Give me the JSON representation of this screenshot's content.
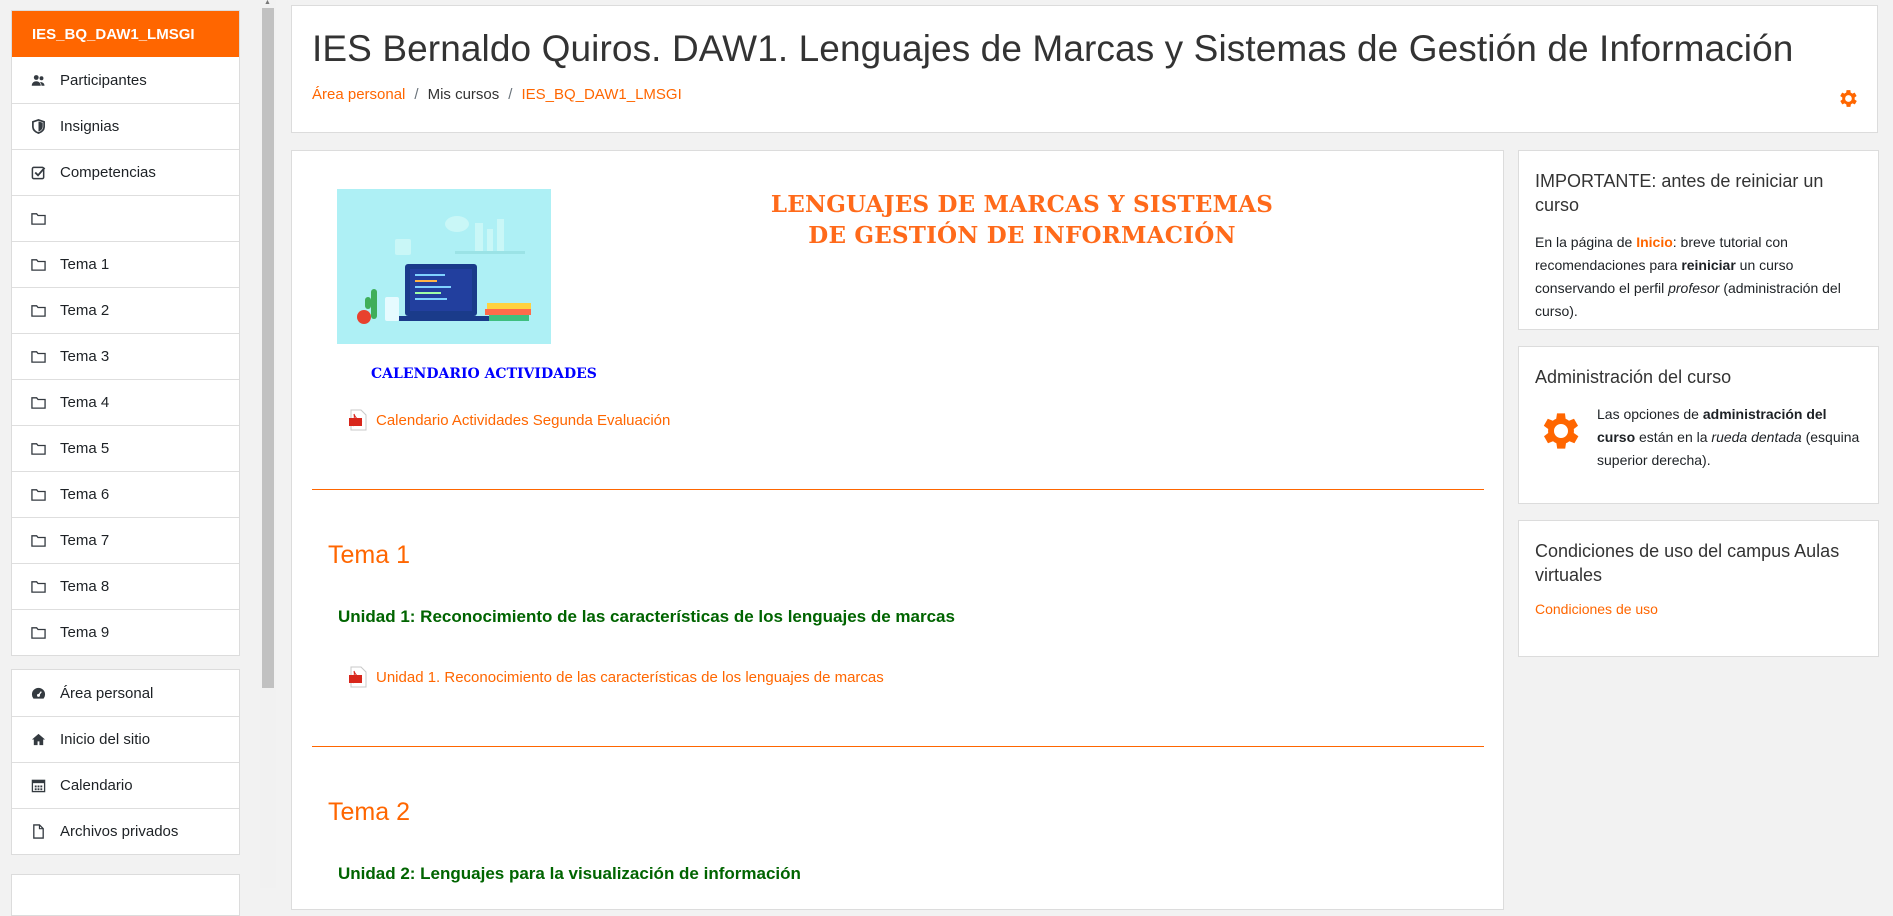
{
  "drawer": {
    "course_short_name": "IES_BQ_DAW1_LMSGI",
    "course_items": [
      {
        "label": "Participantes",
        "icon": "users-icon"
      },
      {
        "label": "Insignias",
        "icon": "shield-icon"
      },
      {
        "label": "Competencias",
        "icon": "checkbox-icon"
      },
      {
        "label": "",
        "icon": "folder-icon"
      },
      {
        "label": "Tema 1",
        "icon": "folder-icon"
      },
      {
        "label": "Tema 2",
        "icon": "folder-icon"
      },
      {
        "label": "Tema 3",
        "icon": "folder-icon"
      },
      {
        "label": "Tema 4",
        "icon": "folder-icon"
      },
      {
        "label": "Tema 5",
        "icon": "folder-icon"
      },
      {
        "label": "Tema 6",
        "icon": "folder-icon"
      },
      {
        "label": "Tema 7",
        "icon": "folder-icon"
      },
      {
        "label": "Tema 8",
        "icon": "folder-icon"
      },
      {
        "label": "Tema 9",
        "icon": "folder-icon"
      }
    ],
    "general_items": [
      {
        "label": "Área personal",
        "icon": "dashboard-icon"
      },
      {
        "label": "Inicio del sitio",
        "icon": "home-icon"
      },
      {
        "label": "Calendario",
        "icon": "calendar-icon"
      },
      {
        "label": "Archivos privados",
        "icon": "file-icon"
      }
    ]
  },
  "header": {
    "title": "IES Bernaldo Quiros. DAW1. Lenguajes de Marcas y Sistemas de Gestión de Información",
    "breadcrumb": [
      "Área personal",
      "Mis cursos",
      "IES_BQ_DAW1_LMSGI"
    ]
  },
  "course": {
    "heading_line1": "LENGUAJES DE MARCAS Y SISTEMAS",
    "heading_line2": "DE GESTIÓN DE INFORMACIÓN",
    "calendar_title": "CALENDARIO ACTIVIDADES",
    "calendar_resource": "Calendario Actividades Segunda Evaluación",
    "sections": [
      {
        "title": "Tema 1",
        "unit": "Unidad 1: Reconocimiento de las características de los lenguajes de marcas",
        "resource": "Unidad 1. Reconocimiento de las características de los lenguajes de marcas"
      },
      {
        "title": "Tema 2",
        "unit": "Unidad 2: Lenguajes para la visualización de información",
        "resource": ""
      }
    ]
  },
  "blocks": {
    "important": {
      "title": "IMPORTANTE: antes de reiniciar un curso",
      "text_1": "En la página de ",
      "inicio": "Inicio",
      "text_2": ": breve tutorial con recomendaciones para ",
      "reiniciar": "reiniciar",
      "text_3": " un curso conservando el perfil ",
      "profesor": "profesor",
      "text_4": " (administración del curso)."
    },
    "admin": {
      "title": "Administración del curso",
      "text_1": "Las opciones de ",
      "bold": "administración  del curso",
      "text_2": " están en la ",
      "italic": "rueda dentada",
      "text_3": " (esquina superior derecha)."
    },
    "terms": {
      "title": "Condiciones de uso del campus Aulas virtuales",
      "link": "Condiciones de uso"
    }
  },
  "colors": {
    "accent": "#ff6600",
    "unit_green": "#006400",
    "calendar_blue": "#0000ff"
  }
}
